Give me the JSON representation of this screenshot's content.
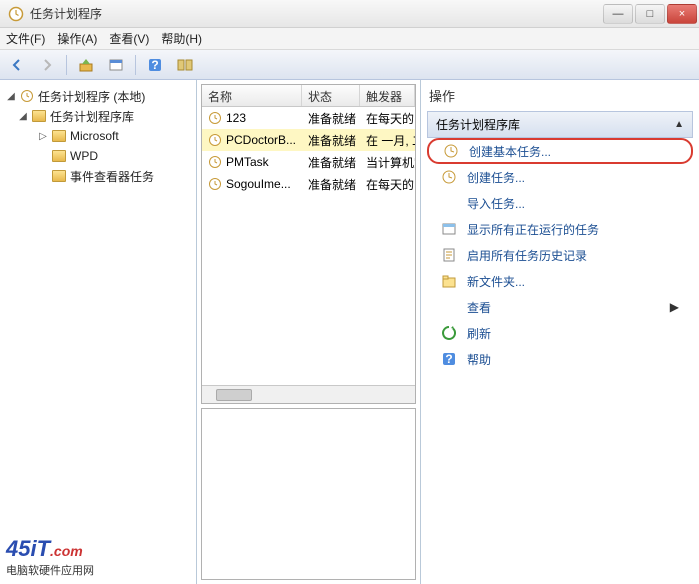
{
  "window": {
    "title": "任务计划程序",
    "min": "—",
    "max": "□",
    "close": "×"
  },
  "menu": {
    "file": "文件(F)",
    "action": "操作(A)",
    "view": "查看(V)",
    "help": "帮助(H)"
  },
  "tree": {
    "root": "任务计划程序 (本地)",
    "lib": "任务计划程序库",
    "n1": "Microsoft",
    "n2": "WPD",
    "n3": "事件查看器任务"
  },
  "grid": {
    "h0": "名称",
    "h1": "状态",
    "h2": "触发器",
    "rows": [
      {
        "name": "123",
        "state": "准备就绪",
        "trigger": "在每天的"
      },
      {
        "name": "PCDoctorB...",
        "state": "准备就绪",
        "trigger": "在 一月, 二"
      },
      {
        "name": "PMTask",
        "state": "准备就绪",
        "trigger": "当计算机空"
      },
      {
        "name": "SogouIme...",
        "state": "准备就绪",
        "trigger": "在每天的"
      }
    ]
  },
  "actions": {
    "title": "操作",
    "section": "任务计划程序库",
    "items": [
      "创建基本任务...",
      "创建任务...",
      "导入任务...",
      "显示所有正在运行的任务",
      "启用所有任务历史记录",
      "新文件夹...",
      "查看",
      "刷新",
      "帮助"
    ]
  },
  "watermark": {
    "brand": "45iT",
    "suffix": ".com",
    "tagline": "电脑软硬件应用网"
  }
}
